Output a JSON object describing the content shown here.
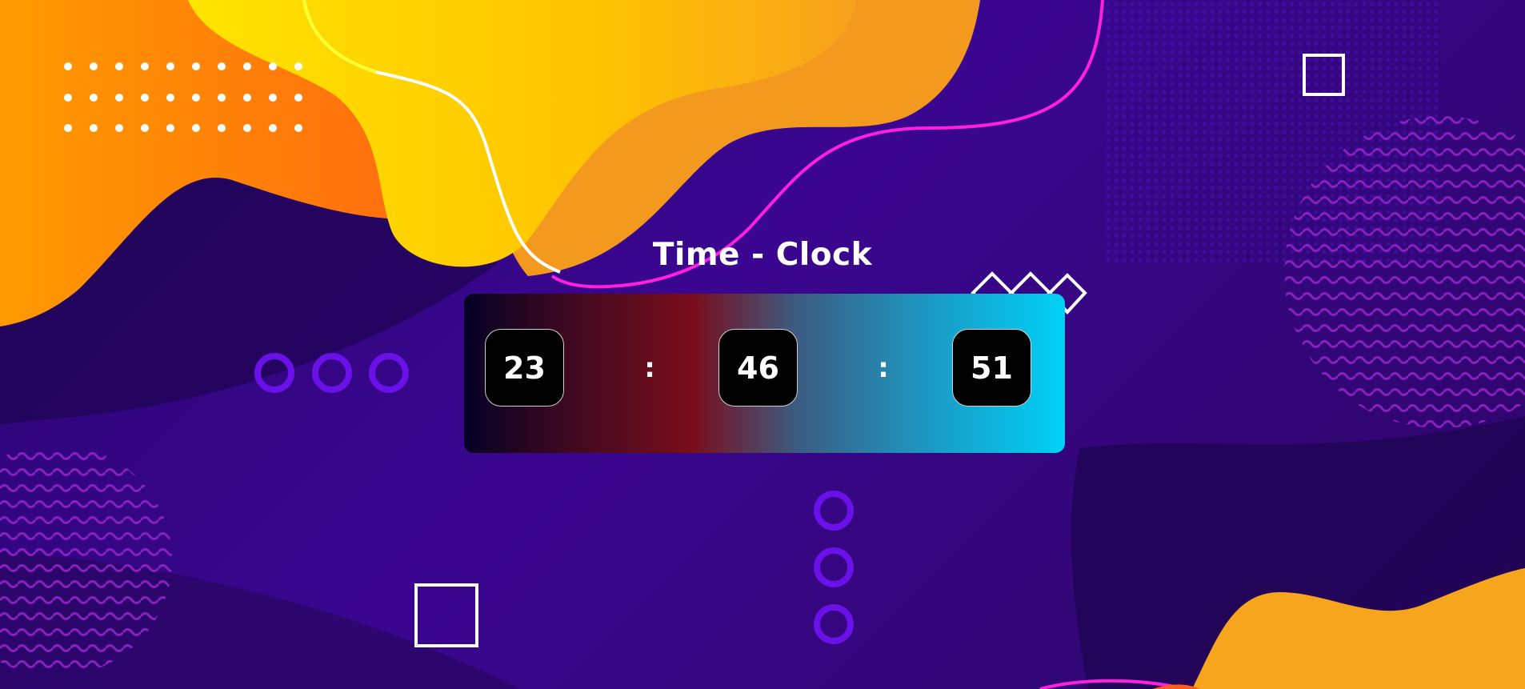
{
  "clock": {
    "title": "Time - Clock",
    "hours": "23",
    "minutes": "46",
    "seconds": "51",
    "separator": ":"
  },
  "colors": {
    "background": "#3a0690",
    "accent_yellow": "#ffcc00",
    "accent_orange": "#f59a1b",
    "accent_magenta": "#ff1fe0",
    "accent_purple_ring": "#6a10e8",
    "panel_start": "#040026",
    "panel_mid": "#7a0d1c",
    "panel_end": "#00d1f6"
  }
}
